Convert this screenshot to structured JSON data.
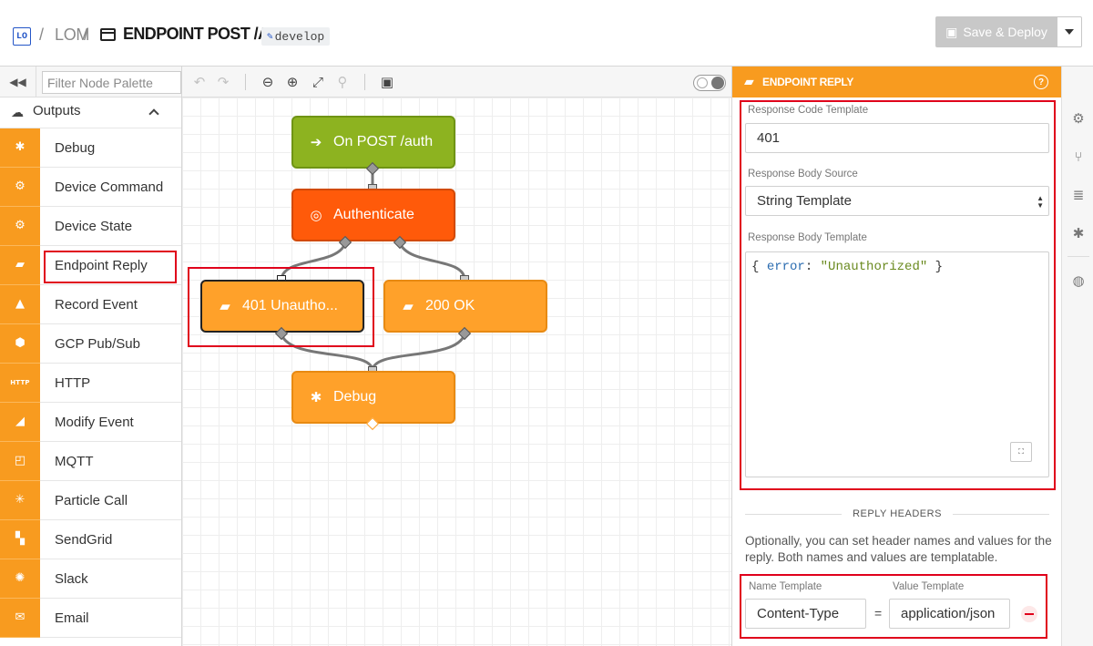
{
  "header": {
    "logo_text": "LO",
    "separator": "/",
    "app_name": "LOM",
    "flow_title": "ENDPOINT POST /AUTH",
    "branch": "develop",
    "save_deploy_label": "Save & Deploy"
  },
  "palette": {
    "filter_placeholder": "Filter Node Palette",
    "category": "Outputs",
    "items": [
      {
        "label": "Debug",
        "icon": "bug-icon"
      },
      {
        "label": "Device Command",
        "icon": "device-command-icon"
      },
      {
        "label": "Device State",
        "icon": "device-state-icon"
      },
      {
        "label": "Endpoint Reply",
        "icon": "endpoint-reply-icon"
      },
      {
        "label": "Record Event",
        "icon": "record-event-icon"
      },
      {
        "label": "GCP Pub/Sub",
        "icon": "gcp-icon"
      },
      {
        "label": "HTTP",
        "icon": "http-icon",
        "icon_text": "HTTP"
      },
      {
        "label": "Modify Event",
        "icon": "modify-event-icon"
      },
      {
        "label": "MQTT",
        "icon": "mqtt-icon"
      },
      {
        "label": "Particle Call",
        "icon": "particle-icon"
      },
      {
        "label": "SendGrid",
        "icon": "sendgrid-icon"
      },
      {
        "label": "Slack",
        "icon": "slack-icon"
      },
      {
        "label": "Email",
        "icon": "email-icon"
      }
    ]
  },
  "canvas": {
    "nodes": [
      {
        "label": "On POST /auth",
        "type": "trigger",
        "color": "#8db320"
      },
      {
        "label": "Authenticate",
        "type": "logic",
        "color": "#ff5a0a"
      },
      {
        "label": "401 Unautho...",
        "type": "output",
        "color": "#ffa12a"
      },
      {
        "label": "200 OK",
        "type": "output",
        "color": "#ffa12a"
      },
      {
        "label": "Debug",
        "type": "output",
        "color": "#ffa12a"
      }
    ]
  },
  "panel": {
    "title": "ENDPOINT REPLY",
    "response_code_label": "Response Code Template",
    "response_code_value": "401",
    "body_source_label": "Response Body Source",
    "body_source_value": "String Template",
    "body_template_label": "Response Body Template",
    "body_template": {
      "open": "{ ",
      "key": "error",
      "colon": ": ",
      "value": "\"Unauthorized\"",
      "close": " }"
    },
    "reply_headers_title": "REPLY HEADERS",
    "reply_headers_desc": "Optionally, you can set header names and values for the reply. Both names and values are templatable.",
    "name_template_label": "Name Template",
    "value_template_label": "Value Template",
    "header_name": "Content-Type",
    "header_value": "application/json",
    "equals": "="
  },
  "colors": {
    "accent_orange": "#f89b1f",
    "trigger_green": "#8db320",
    "logic_red": "#ff5a0a",
    "highlight_red": "#e0001b"
  }
}
